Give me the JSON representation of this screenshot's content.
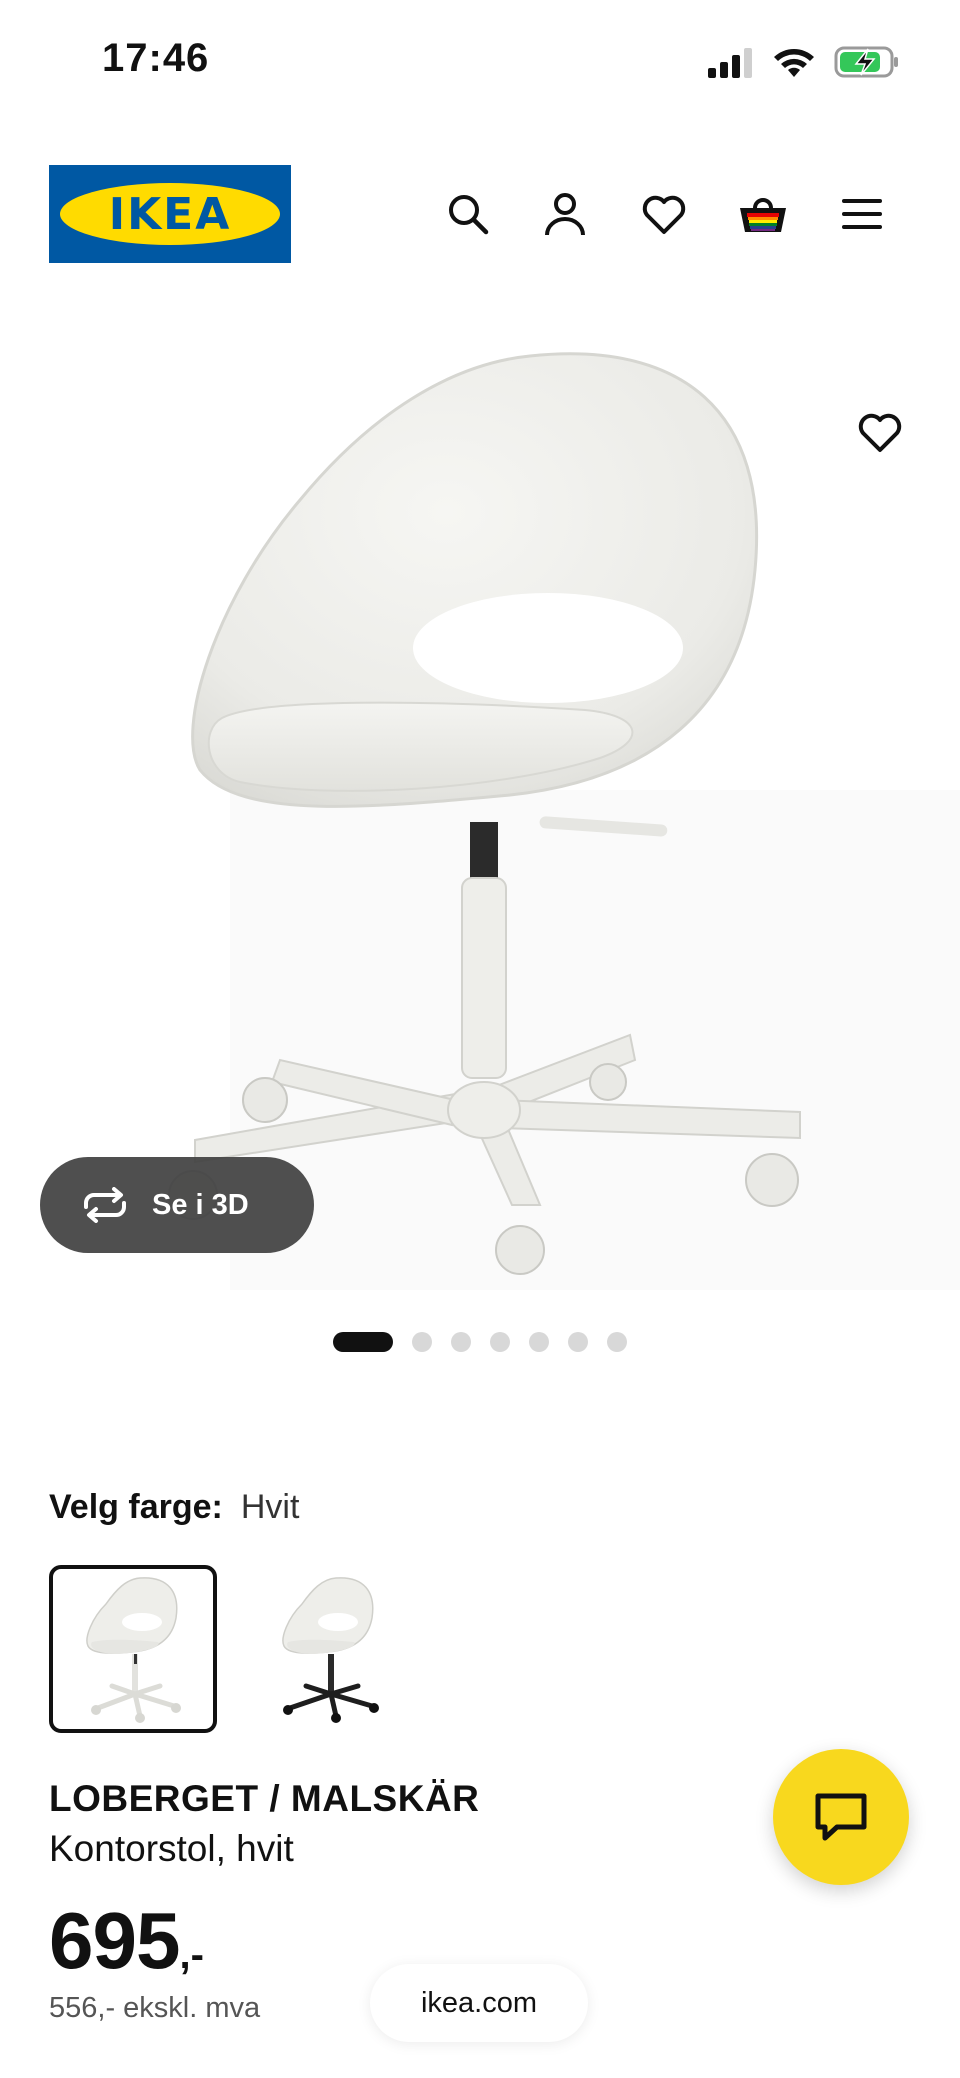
{
  "status_bar": {
    "time": "17:46",
    "icons": [
      "signal-icon",
      "wifi-icon",
      "battery-charging-icon"
    ]
  },
  "header": {
    "logo_text": "IKEA",
    "logo_colors": {
      "blue": "#0058a3",
      "yellow": "#ffdb00"
    },
    "icons": [
      "search-icon",
      "account-icon",
      "heart-icon",
      "basket-icon",
      "menu-icon"
    ]
  },
  "gallery": {
    "view_3d_label": "Se i 3D",
    "image_count": 7,
    "active_index": 0
  },
  "color_choice": {
    "label": "Velg farge:",
    "selected_value": "Hvit",
    "options": [
      "white-chair-thumbnail",
      "black-base-chair-thumbnail"
    ]
  },
  "product": {
    "name": "LOBERGET / MALSKÄR",
    "description": "Kontorstol, hvit",
    "price_main": "695",
    "price_suffix": ",-",
    "price_excl_vat": "556,- ekskl. mva"
  },
  "browser": {
    "url": "ikea.com"
  },
  "colors": {
    "chat_button": "#f8d81e",
    "text": "#111111",
    "pill_3d": "#404040"
  }
}
